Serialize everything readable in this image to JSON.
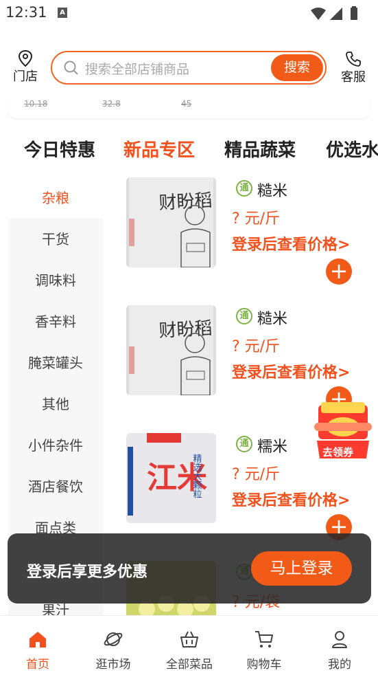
{
  "status_bar": {
    "time": "12:31",
    "notif": "A"
  },
  "header": {
    "store_label": "门店",
    "search_placeholder": "搜索全部店铺商品",
    "search_button": "搜索",
    "service_label": "客服"
  },
  "prev_strip": {
    "prices": [
      "10.18",
      "32.8",
      "45"
    ]
  },
  "tabs": [
    {
      "label": "今日特惠"
    },
    {
      "label": "新品专区"
    },
    {
      "label": "精品蔬菜"
    },
    {
      "label": "优选水果"
    }
  ],
  "active_tab": "新品专区",
  "categories": [
    {
      "label": "杂粮"
    },
    {
      "label": "干货"
    },
    {
      "label": "调味料"
    },
    {
      "label": "香辛料"
    },
    {
      "label": "腌菜罐头"
    },
    {
      "label": "其他"
    },
    {
      "label": "小件杂件"
    },
    {
      "label": "酒店餐饮"
    },
    {
      "label": "面点类"
    },
    {
      "label": ""
    },
    {
      "label": "果汁"
    }
  ],
  "active_category": "杂粮",
  "products": [
    {
      "badge": "通",
      "name": "糙米",
      "price": "? 元/斤",
      "login_hint": "登录后查看价格>",
      "image_text": "财盼稻"
    },
    {
      "badge": "通",
      "name": "糙米",
      "price": "? 元/斤",
      "login_hint": "登录后查看价格>",
      "image_text": "财盼稻"
    },
    {
      "badge": "通",
      "name": "糯米",
      "price": "? 元/斤",
      "login_hint": "登录后查看价格>",
      "image_text": "江米",
      "image_side_text": "精选大颗粒"
    },
    {
      "badge": "通",
      "name": "",
      "price": "? 元/袋",
      "login_hint": "",
      "image_text": ""
    }
  ],
  "add_button": "+",
  "toast": {
    "message": "登录后享更多优惠",
    "button": "马上登录"
  },
  "coupon": {
    "label": "去领券"
  },
  "bottom_nav": [
    {
      "label": "首页",
      "icon": "home-icon"
    },
    {
      "label": "逛市场",
      "icon": "planet-icon"
    },
    {
      "label": "全部菜品",
      "icon": "basket-icon"
    },
    {
      "label": "购物车",
      "icon": "cart-icon"
    },
    {
      "label": "我的",
      "icon": "user-icon"
    }
  ],
  "colors": {
    "accent": "#f2511e",
    "brand_button": "#f25a18",
    "badge_green": "#7cb342"
  }
}
